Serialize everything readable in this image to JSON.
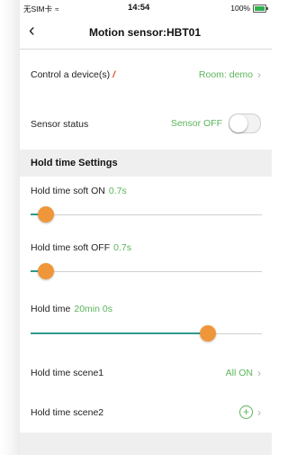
{
  "status_bar": {
    "carrier": "无SIM卡",
    "time": "14:54",
    "battery": "100%"
  },
  "nav": {
    "title": "Motion sensor:HBT01"
  },
  "control_devices": {
    "label": "Control a device(s)",
    "value": "Room: demo"
  },
  "sensor_status": {
    "label": "Sensor status",
    "value": "Sensor OFF",
    "toggle_on": false
  },
  "section": {
    "title": "Hold time Settings"
  },
  "sliders": [
    {
      "label": "Hold time soft ON",
      "value": "0.7s",
      "level": 0.03
    },
    {
      "label": "Hold time soft OFF",
      "value": "0.7s",
      "level": 0.03
    },
    {
      "label": "Hold time",
      "value": "20min 0s",
      "level": 0.73
    }
  ],
  "scene1": {
    "label": "Hold time scene1",
    "value": "All ON"
  },
  "scene2": {
    "label": "Hold time scene2"
  },
  "colors": {
    "accent_green": "#5ab55a",
    "thumb_orange": "#f0963a",
    "fill_teal": "#2f9a8a"
  }
}
